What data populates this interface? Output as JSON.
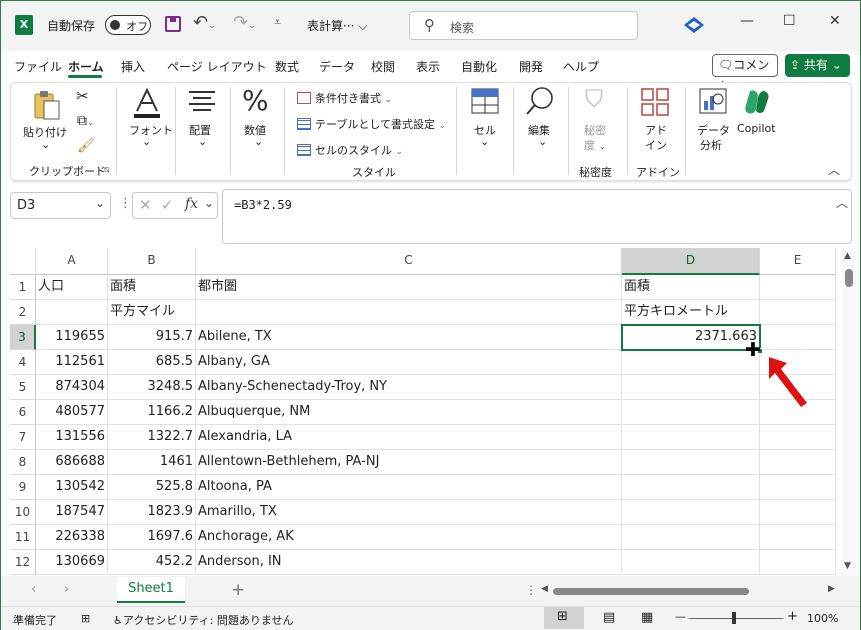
{
  "titlebar": {
    "autosave_label": "自動保存",
    "autosave_state": "オフ",
    "file_name": "表計算···",
    "search_placeholder": "検索",
    "minimize": "—",
    "maximize": "☐",
    "close": "✕"
  },
  "tabs": [
    {
      "label": "ファイル"
    },
    {
      "label": "ホーム"
    },
    {
      "label": "挿入"
    },
    {
      "label": "ページ レイアウト"
    },
    {
      "label": "数式"
    },
    {
      "label": "データ"
    },
    {
      "label": "校閲"
    },
    {
      "label": "表示"
    },
    {
      "label": "自動化"
    },
    {
      "label": "開発"
    },
    {
      "label": "ヘルプ"
    }
  ],
  "comment_label": "コメント",
  "share_label": "共有",
  "ribbon": {
    "paste": "貼り付け",
    "clipboard": "クリップボード",
    "font": "フォント",
    "alignment": "配置",
    "number": "数値",
    "cond_format": "条件付き書式",
    "table_format": "テーブルとして書式設定",
    "cell_style": "セルのスタイル",
    "styles": "スタイル",
    "cells": "セル",
    "editing": "編集",
    "sensitivity_1": "秘密",
    "sensitivity_2": "度",
    "sensitivity_group": "秘密度",
    "addin_1": "アド",
    "addin_2": "イン",
    "addin_group": "アドイン",
    "data_analysis_1": "データ",
    "data_analysis_2": "分析",
    "copilot": "Copilot"
  },
  "formula_bar": {
    "name_box": "D3",
    "formula": "=B3*2.59"
  },
  "columns": [
    "A",
    "B",
    "C",
    "D",
    "E"
  ],
  "rows": [
    {
      "num": "1",
      "a": "人口",
      "b": "面積",
      "c": "都市圏",
      "d": "面積"
    },
    {
      "num": "2",
      "a": "",
      "b": "平方マイル",
      "c": "",
      "d": "平方キロメートル"
    },
    {
      "num": "3",
      "a": "119655",
      "b": "915.7",
      "c": "Abilene, TX",
      "d": "2371.663"
    },
    {
      "num": "4",
      "a": "112561",
      "b": "685.5",
      "c": "Albany, GA",
      "d": ""
    },
    {
      "num": "5",
      "a": "874304",
      "b": "3248.5",
      "c": "Albany-Schenectady-Troy, NY",
      "d": ""
    },
    {
      "num": "6",
      "a": "480577",
      "b": "1166.2",
      "c": "Albuquerque, NM",
      "d": ""
    },
    {
      "num": "7",
      "a": "131556",
      "b": "1322.7",
      "c": "Alexandria, LA",
      "d": ""
    },
    {
      "num": "8",
      "a": "686688",
      "b": "1461",
      "c": "Allentown-Bethlehem, PA-NJ",
      "d": ""
    },
    {
      "num": "9",
      "a": "130542",
      "b": "525.8",
      "c": "Altoona, PA",
      "d": ""
    },
    {
      "num": "10",
      "a": "187547",
      "b": "1823.9",
      "c": "Amarillo, TX",
      "d": ""
    },
    {
      "num": "11",
      "a": "226338",
      "b": "1697.6",
      "c": "Anchorage, AK",
      "d": ""
    },
    {
      "num": "12",
      "a": "130669",
      "b": "452.2",
      "c": "Anderson, IN",
      "d": ""
    }
  ],
  "sheet_tab": "Sheet1",
  "status": {
    "ready": "準備完了",
    "accessibility": "アクセシビリティ: 問題ありません",
    "zoom": "100%"
  },
  "colors": {
    "accent": "#107c41",
    "pointer_arrow": "#e01010"
  }
}
